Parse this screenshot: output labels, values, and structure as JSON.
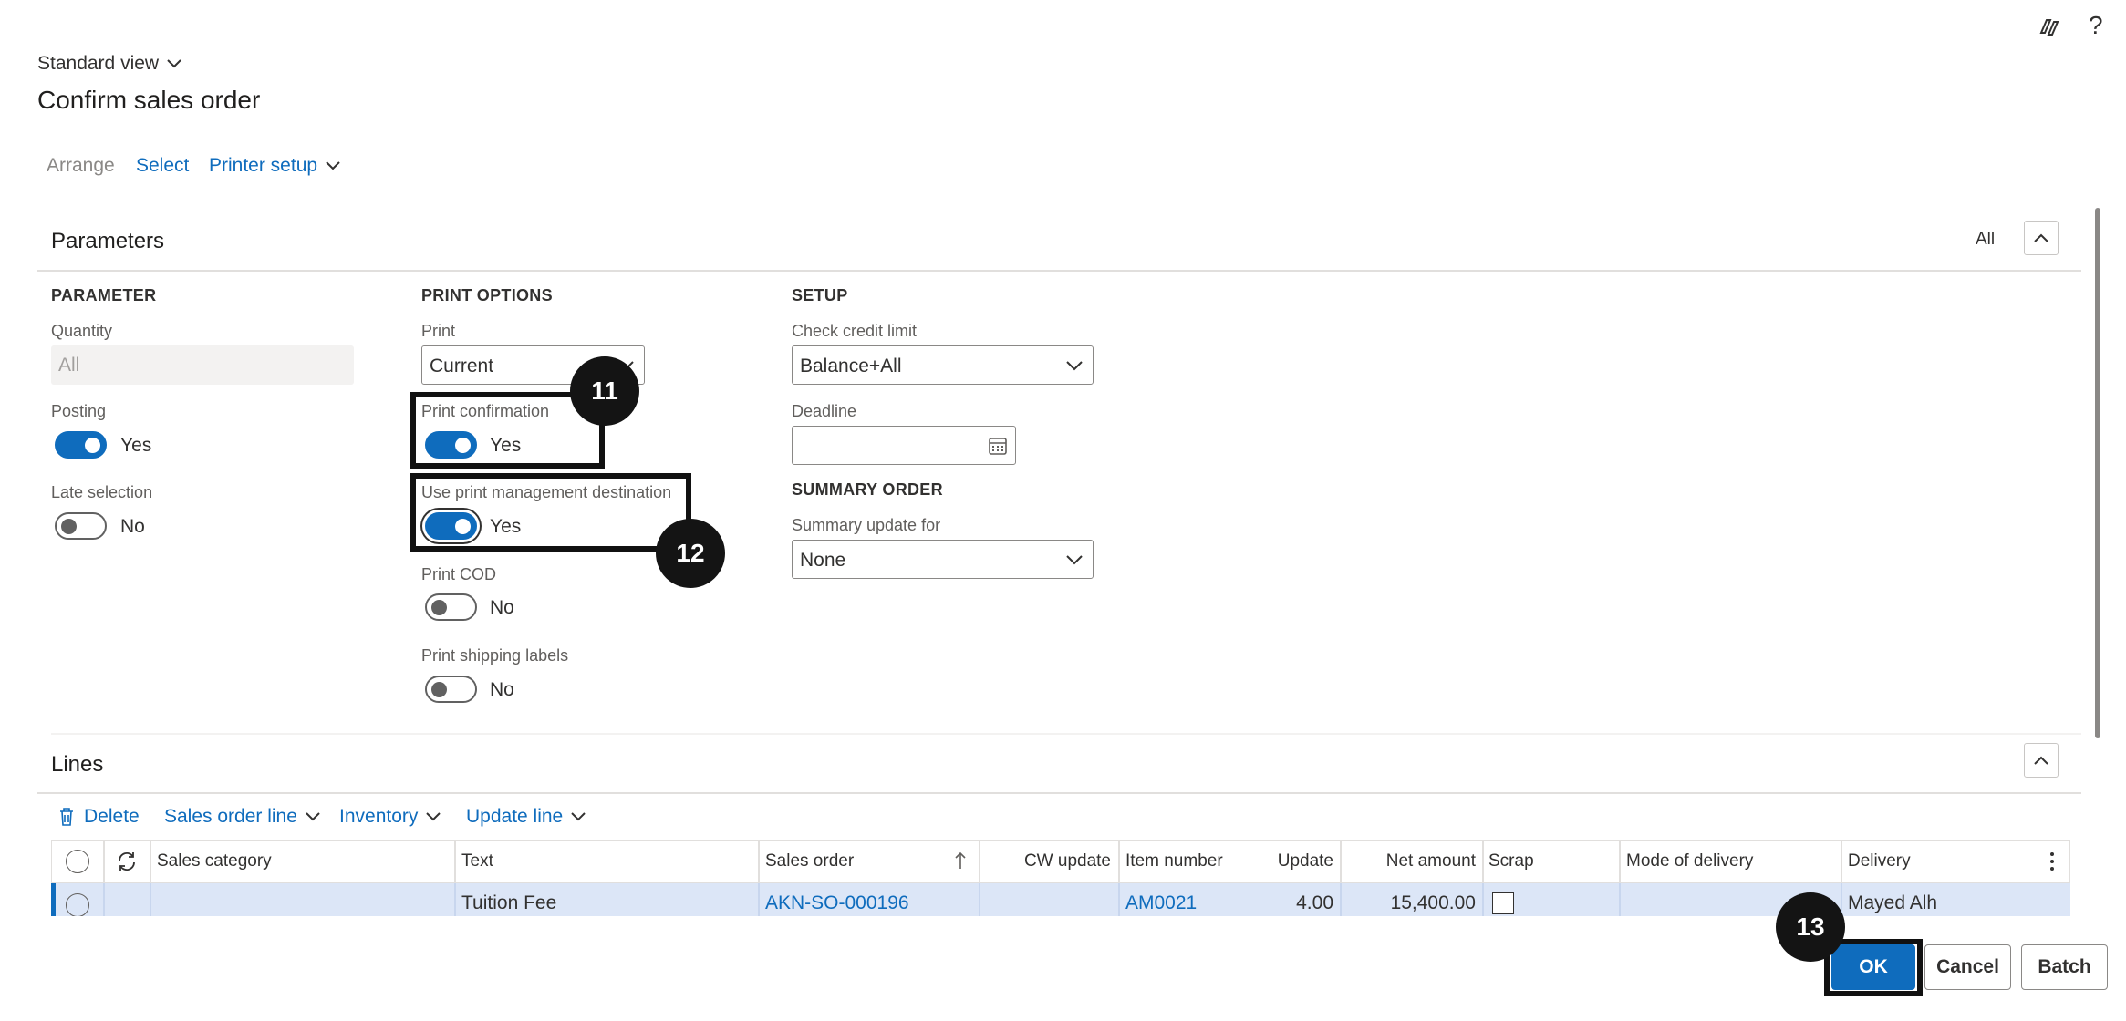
{
  "header": {
    "view_label": "Standard view",
    "page_title": "Confirm sales order"
  },
  "toolbar": {
    "arrange": "Arrange",
    "select": "Select",
    "printer_setup": "Printer setup"
  },
  "parameters": {
    "title": "Parameters",
    "all_label": "All",
    "parameter_group": {
      "header": "PARAMETER",
      "quantity_label": "Quantity",
      "quantity_value": "All",
      "posting_label": "Posting",
      "posting_value": "Yes",
      "late_selection_label": "Late selection",
      "late_selection_value": "No"
    },
    "print_options": {
      "header": "PRINT OPTIONS",
      "print_label": "Print",
      "print_value": "Current",
      "print_confirmation_label": "Print confirmation",
      "print_confirmation_value": "Yes",
      "use_print_mgmt_label": "Use print management destination",
      "use_print_mgmt_value": "Yes",
      "print_cod_label": "Print COD",
      "print_cod_value": "No",
      "print_shipping_label": "Print shipping labels",
      "print_shipping_value": "No"
    },
    "setup": {
      "header": "SETUP",
      "check_credit_label": "Check credit limit",
      "check_credit_value": "Balance+All",
      "deadline_label": "Deadline",
      "deadline_value": ""
    },
    "summary_order": {
      "header": "SUMMARY ORDER",
      "summary_update_label": "Summary update for",
      "summary_update_value": "None"
    }
  },
  "lines": {
    "title": "Lines",
    "actions": {
      "delete": "Delete",
      "sales_order_line": "Sales order line",
      "inventory": "Inventory",
      "update_line": "Update line"
    },
    "columns": {
      "sales_category": "Sales category",
      "text": "Text",
      "sales_order": "Sales order",
      "cw_update": "CW update",
      "item_number": "Item number",
      "update": "Update",
      "net_amount": "Net amount",
      "scrap": "Scrap",
      "mode_of_delivery": "Mode of delivery",
      "delivery": "Delivery"
    },
    "rows": [
      {
        "sales_category": "",
        "text": "Tuition Fee",
        "sales_order": "AKN-SO-000196",
        "cw_update": "",
        "item_number": "AM0021",
        "update": "4.00",
        "net_amount": "15,400.00",
        "scrap": "",
        "mode_of_delivery": "",
        "delivery": "Mayed Alh"
      }
    ]
  },
  "callouts": {
    "step_11": "11",
    "step_12": "12",
    "step_13": "13"
  },
  "footer": {
    "ok": "OK",
    "cancel": "Cancel",
    "batch": "Batch"
  },
  "icons": {
    "copilot": "copilot-icon",
    "help": "?"
  },
  "colors": {
    "accent": "#0f6cbd",
    "selected_row": "#dce6f7",
    "callout": "#141414"
  }
}
